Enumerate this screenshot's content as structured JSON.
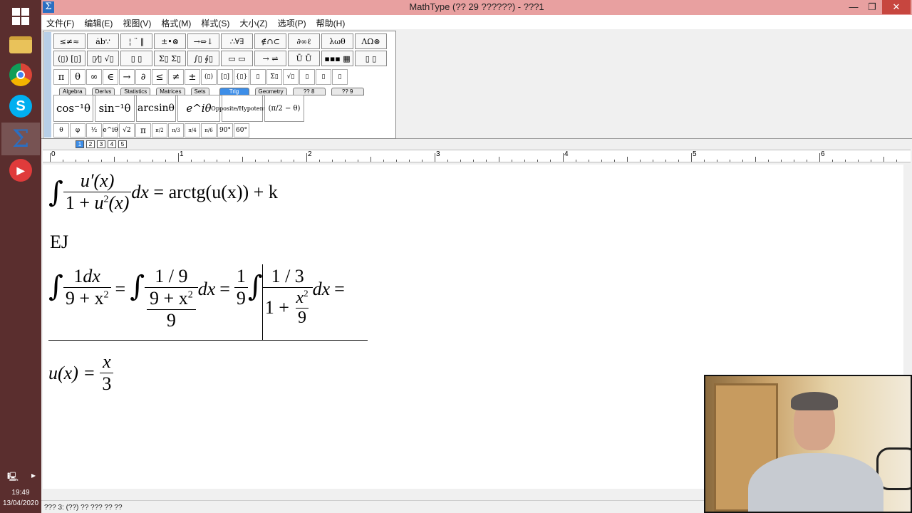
{
  "taskbar": {
    "clock_time": "19:49",
    "clock_date": "13/04/2020",
    "items": [
      {
        "name": "start-windows-icon"
      },
      {
        "name": "file-explorer-icon"
      },
      {
        "name": "chrome-icon"
      },
      {
        "name": "skype-icon"
      },
      {
        "name": "mathtype-icon"
      },
      {
        "name": "camera-recorder-icon"
      }
    ]
  },
  "window": {
    "title": "MathType (?? 29 ??????) - ???1",
    "minimize": "—",
    "restore": "❐",
    "close": "✕"
  },
  "menu": [
    "文件(F)",
    "编辑(E)",
    "视图(V)",
    "格式(M)",
    "样式(S)",
    "大小(Z)",
    "选项(P)",
    "帮助(H)"
  ],
  "palette": {
    "row1": [
      "≤≠≈",
      "ȧb∵",
      "¦ ¨ ‖",
      "±•⊗",
      "→⇔↓",
      "∴∀∃",
      "∉∩⊂",
      "∂∞ℓ",
      "λωθ",
      "ΛΩ⊛"
    ],
    "row2": [
      "(▯) [▯]",
      "▯⁄▯ √▯",
      "▯ ▯",
      "Σ▯ Σ▯",
      "∫▯ ∮▯",
      "▭ ▭",
      "→ ⇌",
      "Ū Ū",
      "▪▪▪ ▦",
      "▯ ▯"
    ],
    "row3": [
      "π",
      "θ",
      "∞",
      "∈",
      "→",
      "∂",
      "≤",
      "≠",
      "±",
      "(▯)",
      "[▯]",
      "{▯}",
      "▯",
      "Σ▯",
      "√▯",
      "▯",
      "▯",
      "▯"
    ],
    "tabs": [
      "Algebra",
      "Derivs",
      "Statistics",
      "Matrices",
      "Sets",
      "Trig",
      "Geometry",
      "?? 8",
      "?? 9"
    ],
    "active_tab": "Trig",
    "templates": [
      "cos⁻¹θ",
      "sin⁻¹θ",
      "arcsinθ",
      "e^iθ",
      "Opposite/Hypotenuse",
      "(π/2 − θ)"
    ],
    "small": [
      "θ",
      "φ",
      "½",
      "e^iθ",
      "√2",
      "π",
      "π/2",
      "π/3",
      "π/4",
      "π/6",
      "90°",
      "60°"
    ]
  },
  "sizes": [
    "1",
    "2",
    "3",
    "4",
    "5"
  ],
  "ruler": [
    "0",
    "1",
    "2",
    "3",
    "4",
    "5",
    "6"
  ],
  "equations": {
    "eq1_num": "u′(x)",
    "eq1_den_a": "1 + ",
    "eq1_den_u": "u",
    "eq1_den_sup": "2",
    "eq1_den_b": "(x)",
    "eq1_dx": "dx",
    "eq1_rhs": " = arctg(u(x)) + k",
    "ej": "EJ",
    "eq2_n1": "1dx",
    "eq2_d1": "9 + x",
    "eq2_eq": "=",
    "eq2_n2": "1 / 9",
    "eq2_d2a": "9 + x",
    "eq2_d2b": "9",
    "eq2_dx": "dx",
    "eq2_f3n": "1",
    "eq2_f3d": "9",
    "eq2_n4": "1 / 3",
    "eq2_d4a": "1 + ",
    "eq2_d4xn": "x",
    "eq2_d4xd": "9",
    "eq2_sup": "2",
    "eq3_lhs": "u(x) = ",
    "eq3_num": "x",
    "eq3_den": "3"
  },
  "status": "??? 3: (??) ?? ??? ?? ??"
}
